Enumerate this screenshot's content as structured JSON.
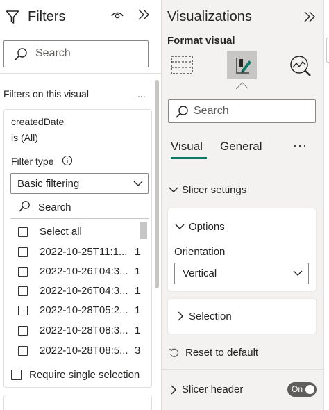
{
  "filters": {
    "title": "Filters",
    "search_placeholder": "Search",
    "section_label": "Filters on this visual",
    "more_label": "...",
    "card": {
      "field": "createdDate",
      "condition": "is (All)",
      "filter_type_label": "Filter type",
      "filter_type_value": "Basic filtering",
      "inner_search_placeholder": "Search",
      "select_all": "Select all",
      "items": [
        {
          "label": "2022-10-25T11:1...",
          "count": "1"
        },
        {
          "label": "2022-10-26T04:3...",
          "count": "1"
        },
        {
          "label": "2022-10-26T04:3...",
          "count": "1"
        },
        {
          "label": "2022-10-28T05:2...",
          "count": "1"
        },
        {
          "label": "2022-10-28T08:3...",
          "count": "1"
        },
        {
          "label": "2022-10-28T08:5...",
          "count": "3"
        }
      ],
      "require_single": "Require single selection"
    }
  },
  "viz": {
    "title": "Visualizations",
    "format_visual": "Format visual",
    "search_placeholder": "Search",
    "tabs": [
      {
        "label": "Visual",
        "active": true
      },
      {
        "label": "General",
        "active": false
      }
    ],
    "more_label": "···",
    "slicer_settings": "Slicer settings",
    "options": {
      "title": "Options",
      "orientation_label": "Orientation",
      "orientation_value": "Vertical"
    },
    "selection": "Selection",
    "reset": "Reset to default",
    "slicer_header": "Slicer header",
    "toggle_label": "On"
  },
  "colors": {
    "accent": "#117865",
    "toggle_bg": "#605e5c",
    "pane_bg": "#f3f2f1"
  }
}
